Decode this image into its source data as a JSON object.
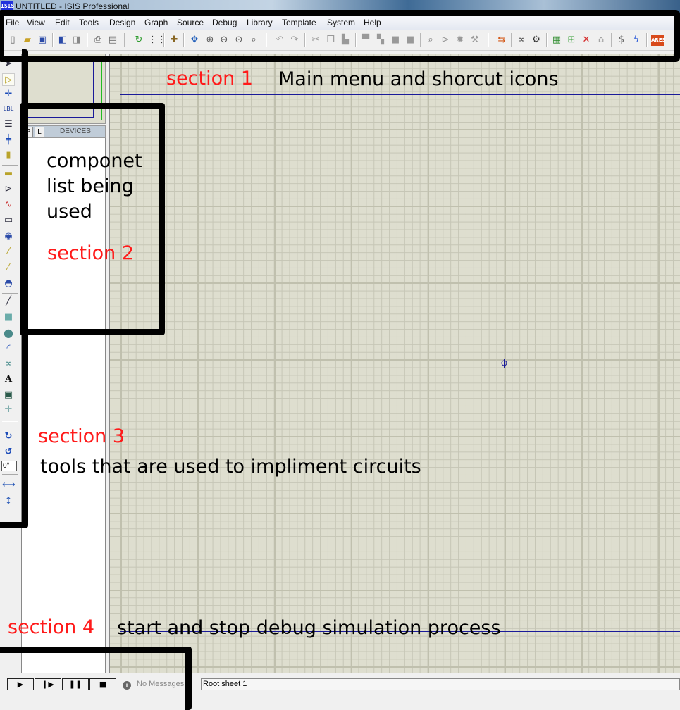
{
  "window": {
    "app_icon": "ISIS",
    "title": "UNTITLED - ISIS Professional"
  },
  "menu": [
    "File",
    "View",
    "Edit",
    "Tools",
    "Design",
    "Graph",
    "Source",
    "Debug",
    "Library",
    "Template",
    "System",
    "Help"
  ],
  "toolbar_icons": [
    "new-file-icon",
    "open-folder-icon",
    "save-icon",
    "import-icon",
    "export-icon",
    "print-icon",
    "print-area-icon",
    "redraw-icon",
    "grid-icon",
    "origin-icon",
    "pan-icon",
    "zoom-in-icon",
    "zoom-out-icon",
    "zoom-all-icon",
    "zoom-area-icon",
    "undo-icon",
    "redo-icon",
    "cut-icon",
    "copy-icon",
    "paste-icon",
    "block-copy-icon",
    "block-move-icon",
    "block-rotate-icon",
    "block-delete-icon",
    "pick-device-icon",
    "make-device-icon",
    "packaging-tool-icon",
    "decompose-icon",
    "wire-autorouter-icon",
    "search-tag-icon",
    "property-assignment-icon",
    "new-sheet-icon",
    "add-sheet-icon",
    "remove-sheet-icon",
    "goto-child-icon",
    "bill-of-materials-icon",
    "electrical-rules-check-icon",
    "ares-netlist-icon"
  ],
  "device_panel": {
    "tab_p": "P",
    "tab_l": "L",
    "header": "DEVICES"
  },
  "left_tools": [
    "selection-mode-icon",
    "component-mode-icon",
    "junction-dot-icon",
    "wire-label-icon",
    "text-script-icon",
    "buses-icon",
    "subcircuit-icon",
    "terminals-icon",
    "device-pins-icon",
    "graph-icon",
    "tape-recorder-icon",
    "generator-icon",
    "voltage-probe-icon",
    "current-probe-icon",
    "virtual-instruments-icon",
    "line-icon",
    "box-icon",
    "circle-icon",
    "arc-icon",
    "closed-path-icon",
    "text-icon",
    "symbol-icon",
    "marker-icon",
    "rotate-cw-icon",
    "rotate-ccw-icon",
    "mirror-x-icon",
    "mirror-y-icon"
  ],
  "rotation_angle": "0°",
  "simulation": {
    "play": "▶",
    "step": "▶",
    "pause": "❚❚",
    "stop": "■"
  },
  "status": {
    "messages": "No Messages",
    "sheet": "Root sheet 1"
  },
  "annotations": {
    "s1_label": "section 1",
    "s1_desc": "Main menu and shorcut icons",
    "s2_line1": "componet",
    "s2_line2": "list being",
    "s2_line3": "used",
    "s2_label": "section 2",
    "s3_label": "section 3",
    "s3_desc": "tools that are used to impliment circuits",
    "s4_label": "section 4",
    "s4_desc": "start and stop debug simulation process"
  },
  "colors": {
    "canvas": "#dedecf",
    "annotation_red": "#ff1a1a",
    "sheet_border": "#1a1a99"
  }
}
